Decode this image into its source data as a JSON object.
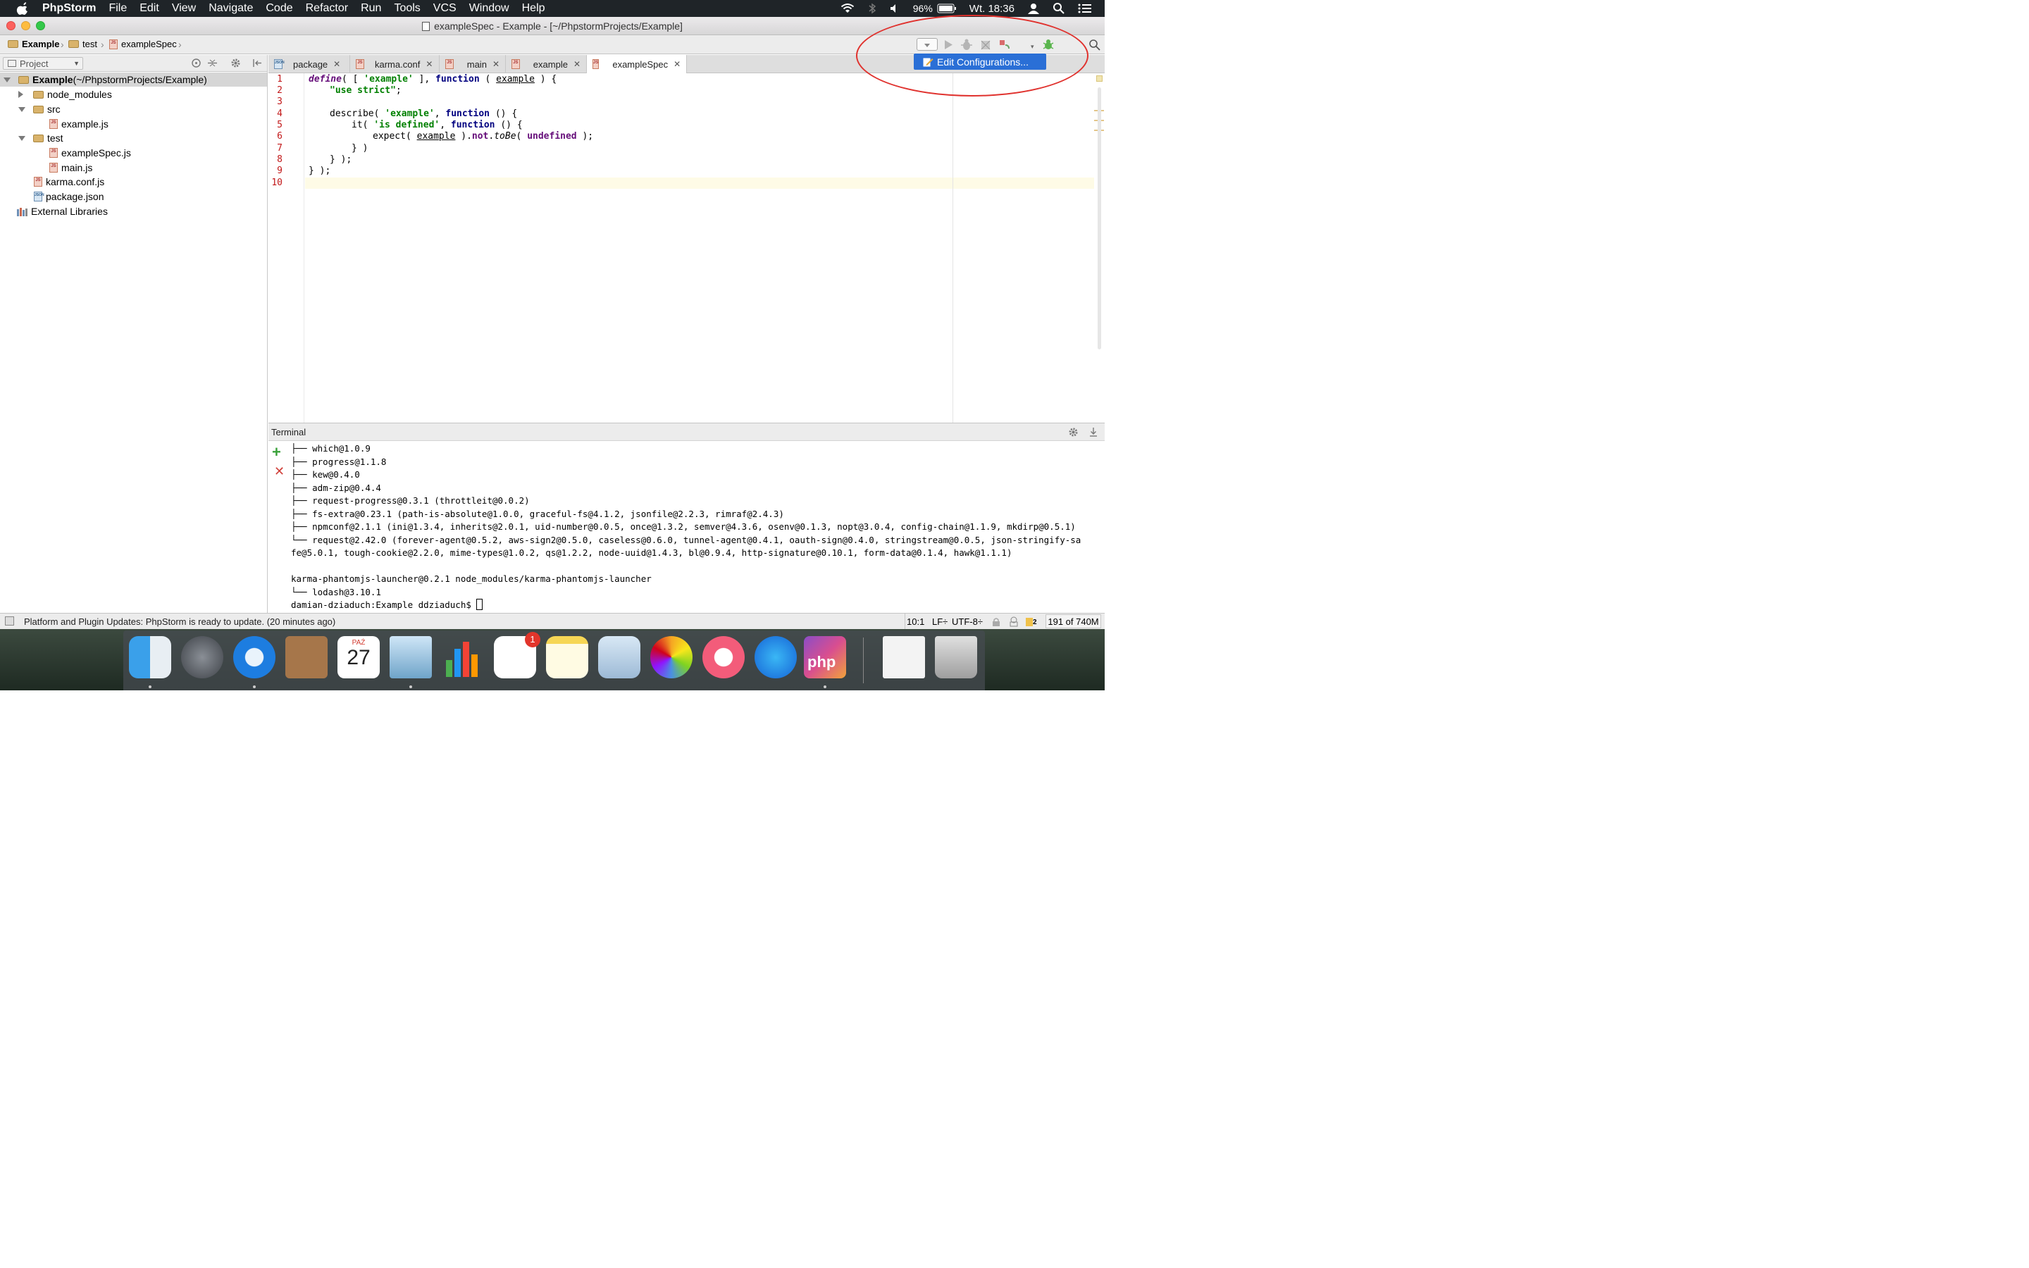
{
  "menubar": {
    "app": "PhpStorm",
    "items": [
      "File",
      "Edit",
      "View",
      "Navigate",
      "Code",
      "Refactor",
      "Run",
      "Tools",
      "VCS",
      "Window",
      "Help"
    ],
    "battery": "96%",
    "clock": "Wt. 18:36"
  },
  "window": {
    "title": "exampleSpec - Example - [~/PhpstormProjects/Example]"
  },
  "breadcrumb": {
    "items": [
      "Example",
      "test",
      "exampleSpec"
    ]
  },
  "run_popup": {
    "label": "Edit Configurations..."
  },
  "project_panel": {
    "selector": "Project",
    "tree": [
      {
        "label": "Example",
        "suffix": " (~/PhpstormProjects/Example)"
      },
      {
        "label": "node_modules"
      },
      {
        "label": "src"
      },
      {
        "label": "example.js"
      },
      {
        "label": "test"
      },
      {
        "label": "exampleSpec.js"
      },
      {
        "label": "main.js"
      },
      {
        "label": "karma.conf.js"
      },
      {
        "label": "package.json"
      },
      {
        "label": "External Libraries"
      }
    ]
  },
  "tabs": [
    {
      "label": "package",
      "icon": "JSON"
    },
    {
      "label": "karma.conf",
      "icon": "JS"
    },
    {
      "label": "main",
      "icon": "JS"
    },
    {
      "label": "example",
      "icon": "JS"
    },
    {
      "label": "exampleSpec",
      "icon": "JS"
    }
  ],
  "editor": {
    "line_numbers": [
      "1",
      "2",
      "3",
      "4",
      "5",
      "6",
      "7",
      "8",
      "9",
      "10"
    ],
    "tokens": {
      "define": "define",
      "open1": "( [ ",
      "s_example": "'example'",
      "mid1": " ], ",
      "function": "function",
      "mid2": " ( ",
      "example": "example",
      "end1": " ) {",
      "use_strict": "\"use strict\"",
      "semicolon": ";",
      "describe": "describe( ",
      "comma": ", ",
      "paren_open": " () {",
      "it": "it( ",
      "s_defined": "'is defined'",
      "expect": "expect( ",
      "dot1": " ).",
      "not": "not",
      "dot2": ".",
      "toBe": "toBe",
      "open2": "( ",
      "undefined": "undefined",
      "end6": " );",
      "close7": "} )",
      "close8": "} );",
      "close9": "} );"
    }
  },
  "terminal": {
    "title": "Terminal",
    "lines": [
      "├── which@1.0.9",
      "├── progress@1.1.8",
      "├── kew@0.4.0",
      "├── adm-zip@0.4.4",
      "├── request-progress@0.3.1 (throttleit@0.0.2)",
      "├── fs-extra@0.23.1 (path-is-absolute@1.0.0, graceful-fs@4.1.2, jsonfile@2.2.3, rimraf@2.4.3)",
      "├── npmconf@2.1.1 (ini@1.3.4, inherits@2.0.1, uid-number@0.0.5, once@1.3.2, semver@4.3.6, osenv@0.1.3, nopt@3.0.4, config-chain@1.1.9, mkdirp@0.5.1)",
      "└── request@2.42.0 (forever-agent@0.5.2, aws-sign2@0.5.0, caseless@0.6.0, tunnel-agent@0.4.1, oauth-sign@0.4.0, stringstream@0.0.5, json-stringify-sa",
      "fe@5.0.1, tough-cookie@2.2.0, mime-types@1.0.2, qs@1.2.2, node-uuid@1.4.3, bl@0.9.4, http-signature@0.10.1, form-data@0.1.4, hawk@1.1.1)",
      "",
      "karma-phantomjs-launcher@0.2.1 node_modules/karma-phantomjs-launcher",
      "└── lodash@3.10.1",
      "damian-dziaduch:Example ddziaduch$ "
    ]
  },
  "statusbar": {
    "message": "Platform and Plugin Updates: PhpStorm is ready to update. (20 minutes ago)",
    "position": "10:1",
    "line_sep": "LF÷",
    "encoding": "UTF-8÷",
    "warnings": "2",
    "memory": "191 of 740M"
  },
  "dock": {
    "calendar_month": "PAŹ",
    "calendar_day": "27",
    "reminders_badge": "1",
    "php_label": "php"
  },
  "colors": {
    "accent": "#2a6fd6",
    "annotation": "#e0322e",
    "line_number": "#c2191a"
  }
}
